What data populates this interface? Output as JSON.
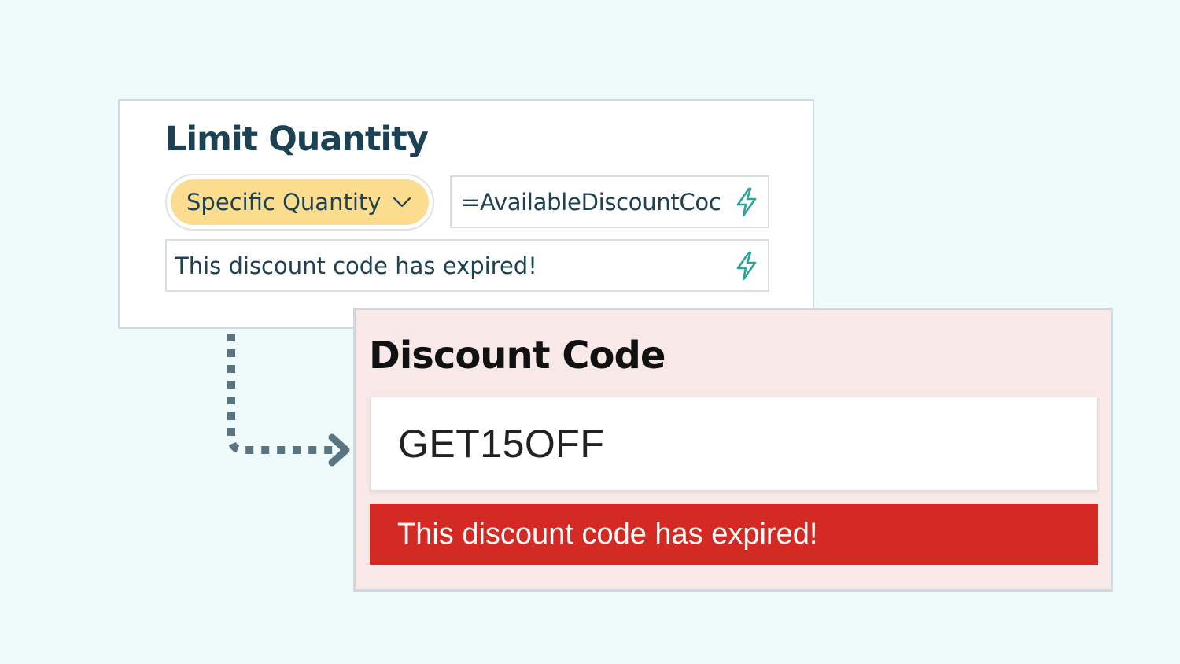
{
  "settings": {
    "title": "Limit Quantity",
    "quantity_select": {
      "selected": "Specific Quantity",
      "icon": "chevron-down-icon"
    },
    "formula_field": {
      "value": "=AvailableDiscountCoc",
      "icon": "lightning-bolt-icon"
    },
    "message_field": {
      "value": "This discount code has expired!",
      "icon": "lightning-bolt-icon"
    }
  },
  "preview": {
    "title": "Discount Code",
    "code_input": {
      "value": "GET15OFF"
    },
    "error_message": "This discount code has expired!"
  },
  "colors": {
    "background": "#effbfb",
    "heading": "#1c4152",
    "select_fill": "#fcdd90",
    "bolt": "#2aa39a",
    "preview_background": "#f8e8e8",
    "error_background": "#d42a24",
    "arrow": "#587581"
  }
}
